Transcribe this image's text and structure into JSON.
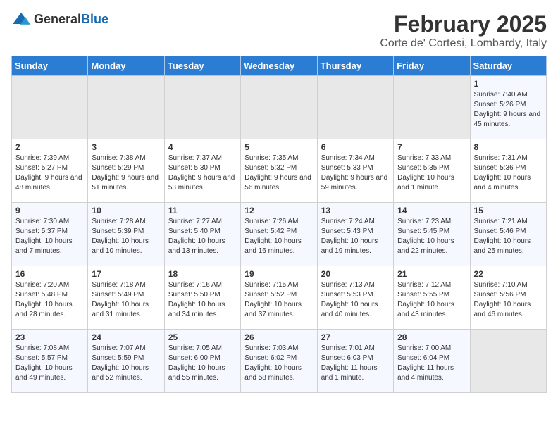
{
  "header": {
    "logo_general": "General",
    "logo_blue": "Blue",
    "title": "February 2025",
    "subtitle": "Corte de' Cortesi, Lombardy, Italy"
  },
  "days_of_week": [
    "Sunday",
    "Monday",
    "Tuesday",
    "Wednesday",
    "Thursday",
    "Friday",
    "Saturday"
  ],
  "weeks": [
    [
      {
        "day": "",
        "info": ""
      },
      {
        "day": "",
        "info": ""
      },
      {
        "day": "",
        "info": ""
      },
      {
        "day": "",
        "info": ""
      },
      {
        "day": "",
        "info": ""
      },
      {
        "day": "",
        "info": ""
      },
      {
        "day": "1",
        "info": "Sunrise: 7:40 AM\nSunset: 5:26 PM\nDaylight: 9 hours and 45 minutes."
      }
    ],
    [
      {
        "day": "2",
        "info": "Sunrise: 7:39 AM\nSunset: 5:27 PM\nDaylight: 9 hours and 48 minutes."
      },
      {
        "day": "3",
        "info": "Sunrise: 7:38 AM\nSunset: 5:29 PM\nDaylight: 9 hours and 51 minutes."
      },
      {
        "day": "4",
        "info": "Sunrise: 7:37 AM\nSunset: 5:30 PM\nDaylight: 9 hours and 53 minutes."
      },
      {
        "day": "5",
        "info": "Sunrise: 7:35 AM\nSunset: 5:32 PM\nDaylight: 9 hours and 56 minutes."
      },
      {
        "day": "6",
        "info": "Sunrise: 7:34 AM\nSunset: 5:33 PM\nDaylight: 9 hours and 59 minutes."
      },
      {
        "day": "7",
        "info": "Sunrise: 7:33 AM\nSunset: 5:35 PM\nDaylight: 10 hours and 1 minute."
      },
      {
        "day": "8",
        "info": "Sunrise: 7:31 AM\nSunset: 5:36 PM\nDaylight: 10 hours and 4 minutes."
      }
    ],
    [
      {
        "day": "9",
        "info": "Sunrise: 7:30 AM\nSunset: 5:37 PM\nDaylight: 10 hours and 7 minutes."
      },
      {
        "day": "10",
        "info": "Sunrise: 7:28 AM\nSunset: 5:39 PM\nDaylight: 10 hours and 10 minutes."
      },
      {
        "day": "11",
        "info": "Sunrise: 7:27 AM\nSunset: 5:40 PM\nDaylight: 10 hours and 13 minutes."
      },
      {
        "day": "12",
        "info": "Sunrise: 7:26 AM\nSunset: 5:42 PM\nDaylight: 10 hours and 16 minutes."
      },
      {
        "day": "13",
        "info": "Sunrise: 7:24 AM\nSunset: 5:43 PM\nDaylight: 10 hours and 19 minutes."
      },
      {
        "day": "14",
        "info": "Sunrise: 7:23 AM\nSunset: 5:45 PM\nDaylight: 10 hours and 22 minutes."
      },
      {
        "day": "15",
        "info": "Sunrise: 7:21 AM\nSunset: 5:46 PM\nDaylight: 10 hours and 25 minutes."
      }
    ],
    [
      {
        "day": "16",
        "info": "Sunrise: 7:20 AM\nSunset: 5:48 PM\nDaylight: 10 hours and 28 minutes."
      },
      {
        "day": "17",
        "info": "Sunrise: 7:18 AM\nSunset: 5:49 PM\nDaylight: 10 hours and 31 minutes."
      },
      {
        "day": "18",
        "info": "Sunrise: 7:16 AM\nSunset: 5:50 PM\nDaylight: 10 hours and 34 minutes."
      },
      {
        "day": "19",
        "info": "Sunrise: 7:15 AM\nSunset: 5:52 PM\nDaylight: 10 hours and 37 minutes."
      },
      {
        "day": "20",
        "info": "Sunrise: 7:13 AM\nSunset: 5:53 PM\nDaylight: 10 hours and 40 minutes."
      },
      {
        "day": "21",
        "info": "Sunrise: 7:12 AM\nSunset: 5:55 PM\nDaylight: 10 hours and 43 minutes."
      },
      {
        "day": "22",
        "info": "Sunrise: 7:10 AM\nSunset: 5:56 PM\nDaylight: 10 hours and 46 minutes."
      }
    ],
    [
      {
        "day": "23",
        "info": "Sunrise: 7:08 AM\nSunset: 5:57 PM\nDaylight: 10 hours and 49 minutes."
      },
      {
        "day": "24",
        "info": "Sunrise: 7:07 AM\nSunset: 5:59 PM\nDaylight: 10 hours and 52 minutes."
      },
      {
        "day": "25",
        "info": "Sunrise: 7:05 AM\nSunset: 6:00 PM\nDaylight: 10 hours and 55 minutes."
      },
      {
        "day": "26",
        "info": "Sunrise: 7:03 AM\nSunset: 6:02 PM\nDaylight: 10 hours and 58 minutes."
      },
      {
        "day": "27",
        "info": "Sunrise: 7:01 AM\nSunset: 6:03 PM\nDaylight: 11 hours and 1 minute."
      },
      {
        "day": "28",
        "info": "Sunrise: 7:00 AM\nSunset: 6:04 PM\nDaylight: 11 hours and 4 minutes."
      },
      {
        "day": "",
        "info": ""
      }
    ]
  ]
}
